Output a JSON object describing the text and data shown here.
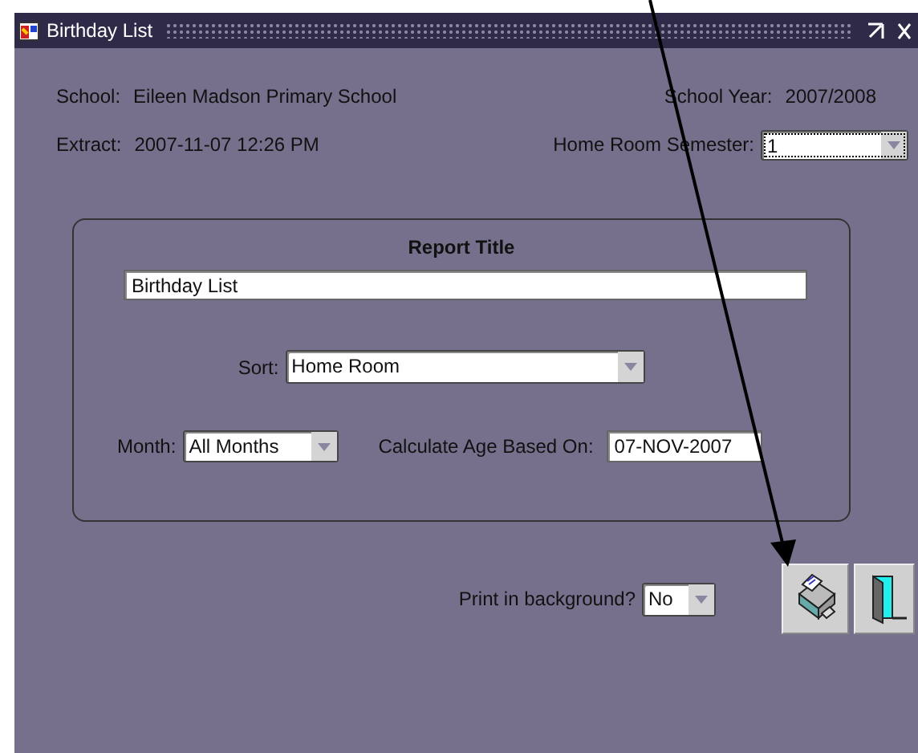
{
  "window": {
    "title": "Birthday List"
  },
  "header": {
    "school_label": "School:",
    "school": "Eileen Madson Primary School",
    "year_label": "School Year:",
    "year": "2007/2008",
    "extract_label": "Extract:",
    "extract": "2007-11-07 12:26 PM",
    "semester_label": "Home Room Semester:",
    "semester": "1"
  },
  "report": {
    "heading": "Report Title",
    "title_value": "Birthday List",
    "sort_label": "Sort:",
    "sort": "Home Room",
    "month_label": "Month:",
    "month": "All Months",
    "age_label": "Calculate Age Based On:",
    "age_date": "07-NOV-2007"
  },
  "footer": {
    "background_label": "Print in background?",
    "background": "No"
  }
}
